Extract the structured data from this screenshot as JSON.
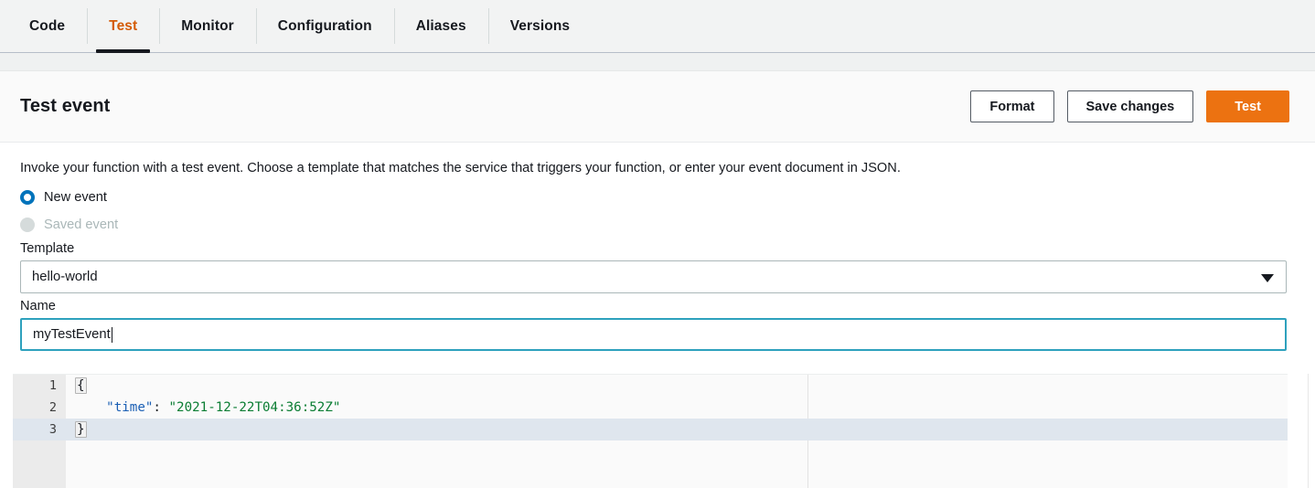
{
  "tabs": [
    {
      "label": "Code",
      "active": false
    },
    {
      "label": "Test",
      "active": true
    },
    {
      "label": "Monitor",
      "active": false
    },
    {
      "label": "Configuration",
      "active": false
    },
    {
      "label": "Aliases",
      "active": false
    },
    {
      "label": "Versions",
      "active": false
    }
  ],
  "panel": {
    "title": "Test event",
    "buttons": {
      "format": "Format",
      "save": "Save changes",
      "test": "Test"
    }
  },
  "body": {
    "intro": "Invoke your function with a test event. Choose a template that matches the service that triggers your function, or enter your event document in JSON.",
    "radios": [
      {
        "label": "New event",
        "selected": true,
        "disabled": false
      },
      {
        "label": "Saved event",
        "selected": false,
        "disabled": true
      }
    ],
    "template": {
      "label": "Template",
      "value": "hello-world"
    },
    "name": {
      "label": "Name",
      "value": "myTestEvent",
      "placeholder": "Event name"
    }
  },
  "editor": {
    "lines": [
      {
        "number": "1",
        "foldable": true,
        "active": false,
        "open_brace": "{"
      },
      {
        "number": "2",
        "foldable": false,
        "active": false,
        "key": "\"time\"",
        "colon": ": ",
        "value": "\"2021-12-22T04:36:52Z\""
      },
      {
        "number": "3",
        "foldable": false,
        "active": true,
        "close_brace": "}"
      }
    ]
  },
  "colors": {
    "accent_orange": "#ec7211",
    "tab_active_text": "#d45b07",
    "radio_blue": "#0073bb",
    "input_focus": "#2ea1bd",
    "json_key": "#1a5fb4",
    "json_string": "#0a7d33",
    "active_line": "#dfe6ee"
  }
}
